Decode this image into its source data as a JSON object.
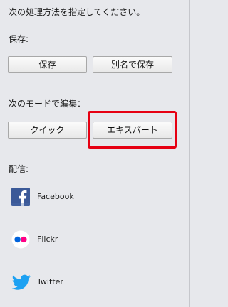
{
  "instruction": "次の処理方法を指定してください。",
  "save_section": {
    "heading": "保存:",
    "save_label": "保存",
    "save_as_label": "別名で保存"
  },
  "edit_section": {
    "heading": "次のモードで編集：",
    "quick_label": "クイック",
    "expert_label": "エキスパート",
    "highlight_color": "#e60012"
  },
  "share_section": {
    "heading": "配信:",
    "items": [
      {
        "label": "Facebook",
        "icon": "facebook-icon"
      },
      {
        "label": "Flickr",
        "icon": "flickr-icon"
      },
      {
        "label": "Twitter",
        "icon": "twitter-icon"
      }
    ]
  },
  "colors": {
    "background": "#e7e8ec",
    "facebook": "#3b5998",
    "flickr_blue": "#0063dc",
    "flickr_pink": "#ff0084",
    "twitter": "#1da1f2"
  }
}
